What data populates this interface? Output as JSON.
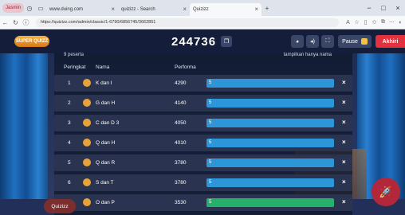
{
  "browser": {
    "profile_label": "Jasmin",
    "tabs": [
      {
        "title": "www.duing.com",
        "close": "×"
      },
      {
        "title": "quizizz - Search",
        "close": "×"
      },
      {
        "title": "Quizizz",
        "close": "×"
      }
    ],
    "new_tab": "+",
    "url": "https://quizizz.com/admin/classic/1-6790/6856745/3662851",
    "window_controls": [
      "−",
      "□",
      "×"
    ]
  },
  "game": {
    "logo_text": "SUPER QUIZZ",
    "join_code": "244736",
    "pause_label": "Pause",
    "end_label": "Akhiri",
    "quizizz_badge": "Quizizz",
    "board_top_left": "9 peserta",
    "board_top_right": "tampilkan hanya nama",
    "columns": {
      "rank": "Peringkat",
      "name": "Nama",
      "score": "Performa"
    },
    "rows": [
      {
        "rank": "1",
        "name": "K dan I",
        "score": "4290",
        "progress": "5",
        "color": "blue"
      },
      {
        "rank": "2",
        "name": "G dan H",
        "score": "4140",
        "progress": "5",
        "color": "blue"
      },
      {
        "rank": "3",
        "name": "C dan D 3",
        "score": "4050",
        "progress": "5",
        "color": "blue"
      },
      {
        "rank": "4",
        "name": "Q dan H",
        "score": "4010",
        "progress": "5",
        "color": "blue"
      },
      {
        "rank": "5",
        "name": "Q dan R",
        "score": "3780",
        "progress": "5",
        "color": "blue"
      },
      {
        "rank": "6",
        "name": "S dan T",
        "score": "3780",
        "progress": "5",
        "color": "blue"
      },
      {
        "rank": "7",
        "name": "O dan P",
        "score": "3530",
        "progress": "5",
        "color": "green"
      }
    ]
  },
  "icons": {
    "back": "back-icon",
    "refresh": "refresh-icon",
    "copy": "copy-icon",
    "theme": "palette-icon",
    "sound": "volume-icon",
    "fullscreen": "fullscreen-icon",
    "rocket": "rocket-icon"
  }
}
